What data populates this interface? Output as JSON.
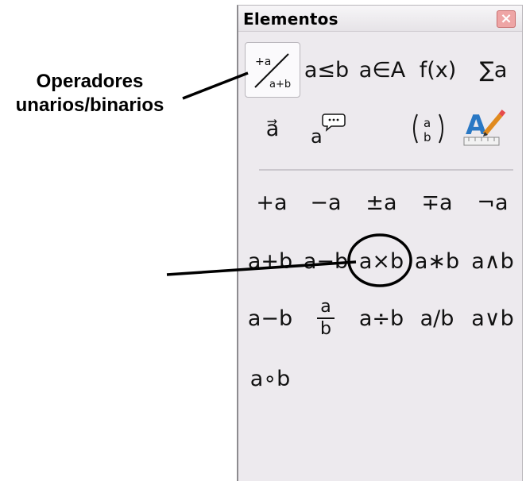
{
  "panel": {
    "title": "Elementos",
    "close_label": "×"
  },
  "categories": [
    {
      "label": "a≤b"
    },
    {
      "label": "a∈A"
    },
    {
      "label": "f(x)"
    },
    {
      "label": "∑a"
    },
    {
      "label": "a⃗"
    }
  ],
  "selected_category": {
    "top": "+a",
    "bottom": "a+b"
  },
  "elements": [
    {
      "label": "+a"
    },
    {
      "label": "−a"
    },
    {
      "label": "±a"
    },
    {
      "label": "∓a"
    },
    {
      "label": "¬a"
    },
    {
      "label": "a+b"
    },
    {
      "label": "a−b"
    },
    {
      "label": "a×b"
    },
    {
      "label": "a∗b"
    },
    {
      "label": "a∧b"
    },
    {
      "label": "a−b"
    },
    {
      "label": "a÷b"
    },
    {
      "label": "a/b"
    },
    {
      "label": "a∨b"
    },
    {
      "label": "a∘b"
    }
  ],
  "fraction_element": {
    "num": "a",
    "den": "b"
  },
  "callout": {
    "line1": "Operadores",
    "line2": "unarios/binarios"
  }
}
